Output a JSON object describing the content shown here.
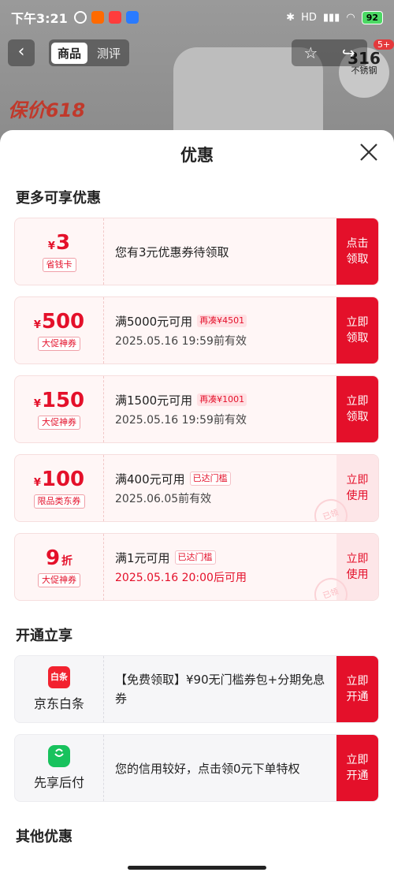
{
  "status": {
    "time": "下午3:21",
    "battery": "92",
    "right_text": "HD"
  },
  "nav": {
    "back": "‹",
    "tab_goods": "商品",
    "tab_review": "测评",
    "badge": "5+"
  },
  "background": {
    "promo": "保价618",
    "badge_line1": "316",
    "badge_line2": "不锈钢"
  },
  "sheet": {
    "title": "优惠",
    "section_more": "更多可享优惠",
    "section_open": "开通立享",
    "section_other": "其他优惠"
  },
  "coupons": [
    {
      "cur": "¥",
      "num": "3",
      "unit": "",
      "tag": "省钱卡",
      "line1": "您有3元优惠券待领取",
      "chip": "",
      "line2": "",
      "action": "点击领取",
      "style": "claim"
    },
    {
      "cur": "¥",
      "num": "500",
      "unit": "",
      "tag": "大促神券",
      "line1": "满5000元可用",
      "chip": "再凑¥4501",
      "line2": "2025.05.16 19:59前有效",
      "action": "立即领取",
      "style": "claim"
    },
    {
      "cur": "¥",
      "num": "150",
      "unit": "",
      "tag": "大促神券",
      "line1": "满1500元可用",
      "chip": "再凑¥1001",
      "line2": "2025.05.16 19:59前有效",
      "action": "立即领取",
      "style": "claim"
    },
    {
      "cur": "¥",
      "num": "100",
      "unit": "",
      "tag": "限品类东券",
      "line1": "满400元可用",
      "chip": "已达门槛",
      "line2": "2025.06.05前有效",
      "action": "立即使用",
      "style": "use"
    },
    {
      "cur": "",
      "num": "9",
      "unit": "折",
      "tag": "大促神券",
      "line1": "满1元可用",
      "chip": "已达门槛",
      "line2": "2025.05.16 20:00后可用",
      "action": "立即使用",
      "style": "use"
    }
  ],
  "stamp": "已领",
  "services": [
    {
      "icon": "白条",
      "name": "京东白条",
      "text": "【免费领取】¥90无门槛券包+分期免息券",
      "action": "立即开通"
    },
    {
      "icon": "",
      "name": "先享后付",
      "text": "您的信用较好，点击领0元下单特权",
      "action": "立即开通"
    }
  ]
}
